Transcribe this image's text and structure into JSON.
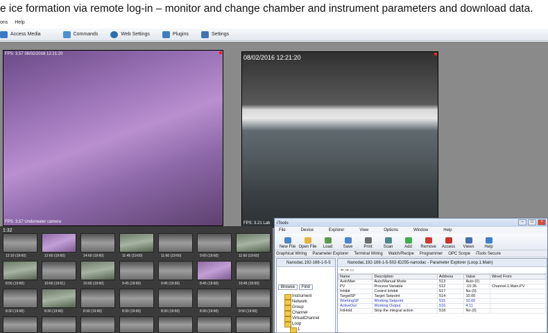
{
  "caption": "e ice formation via remote log-in – monitor and change chamber and instrument parameters and download data.",
  "menubar": [
    "ons",
    "Help"
  ],
  "toolbar": [
    {
      "label": "Access Media",
      "icon": "media-icon",
      "color": "#3a78c8"
    },
    {
      "label": "Commands",
      "icon": "commands-icon",
      "color": "#4d8fd1"
    },
    {
      "label": "Web Settings",
      "icon": "web-settings-icon",
      "color": "#2d6fb3"
    },
    {
      "label": "Plugins",
      "icon": "plugins-icon",
      "color": "#3e7ec0"
    },
    {
      "label": "Settings",
      "icon": "settings-icon",
      "color": "#3f72b5"
    }
  ],
  "camera1": {
    "top_osd": "FPS: 3.57 08/02/2016 12:21:20",
    "bottom_osd": "FPS: 3.57  Underwater camera"
  },
  "camera2": {
    "timestamp": "08/02/2016 12:21:20",
    "bottom_osd": "FPS: 3.21  Lab"
  },
  "thumbnails": {
    "header": "1:32",
    "labels": [
      [
        "12:10 (19:60)",
        "12:60 (19:60)",
        "14:60 (19:60)",
        "11:45 (19:60)",
        "11:60 (19:60)",
        "9:60 (19:60)",
        "11:60 (19:60)"
      ],
      [
        "8:50 (19:60)",
        "10:60 (19:61)",
        "10:60 (19:60)",
        "9:45 (19:60)",
        "9:45 (19:60)",
        "8:45 (19:60)",
        "10:45 (19:60)"
      ],
      [
        "8:30 (19:60)",
        "8:30 (19:60)",
        "8:30 (19:60)",
        "8:30 (19:60)",
        "8:30 (19:60)",
        "8:30 (19:60)",
        "9:50 (19:60)"
      ]
    ]
  },
  "itools": {
    "title": "iTools",
    "menu": [
      "File",
      "Device",
      "Explorer",
      "View",
      "Options",
      "Window",
      "Help"
    ],
    "tools": [
      {
        "label": "New File",
        "color": "#4a86c9"
      },
      {
        "label": "Open File",
        "color": "#e5b43a"
      },
      {
        "label": "Load",
        "color": "#5d9b4a"
      },
      {
        "label": "Save",
        "color": "#4a86c9"
      },
      {
        "label": "Print",
        "color": "#6c6c6c"
      },
      {
        "label": "Scan",
        "color": "#4b8a8f"
      },
      {
        "label": "Add",
        "color": "#3fae4a"
      },
      {
        "label": "Remove",
        "color": "#cc3b2e"
      },
      {
        "label": "Access",
        "color": "#c4362c"
      },
      {
        "label": "Views",
        "color": "#4a6fb0"
      },
      {
        "label": "Help",
        "color": "#3f7fd0"
      }
    ],
    "tabs": [
      "Graphical Wiring",
      "Parameter Explorer",
      "Terminal Wiring",
      "Watch/Recipe",
      "Programmer",
      "OPC Scope",
      "iTools Secure"
    ],
    "left_header": "Nanodac.192-168-1-5-5",
    "browse_tabs": [
      "Browse",
      "Find"
    ],
    "tree": [
      "Instrument",
      "Network",
      "Group",
      "Channel",
      "VirtualChannel",
      "Loop",
      "1"
    ],
    "right_header": "Nanodac.192-168-1-5-502-ID255-nanodac - Parameter Explorer (Loop.1.Main)",
    "columns": [
      "Name",
      "Description",
      "Address",
      "Value",
      "Wired From"
    ],
    "rows": [
      {
        "name": "AutoMan",
        "desc": "Auto/Manual Mode",
        "addr": "513",
        "value": "Auto (0)",
        "wired": "",
        "blue": false
      },
      {
        "name": "PV",
        "desc": "Process Variable",
        "addr": "512",
        "value": "-10.35",
        "wired": "Channel.1.Main.PV",
        "blue": false
      },
      {
        "name": "Inhibit",
        "desc": "Control Inhibit",
        "addr": "517",
        "value": "No (0)",
        "wired": "",
        "blue": false
      },
      {
        "name": "TargetSP",
        "desc": "Target Setpoint",
        "addr": "514",
        "value": "10.00",
        "wired": "",
        "blue": false
      },
      {
        "name": "WorkingSP",
        "desc": "Working Setpoint",
        "addr": "515",
        "value": "10.00",
        "wired": "",
        "blue": true
      },
      {
        "name": "ActiveOut",
        "desc": "Working Output",
        "addr": "516",
        "value": "4.11",
        "wired": "",
        "blue": true
      },
      {
        "name": "IntHold",
        "desc": "Stop the integral action",
        "addr": "518",
        "value": "No (0)",
        "wired": "",
        "blue": false
      }
    ]
  }
}
